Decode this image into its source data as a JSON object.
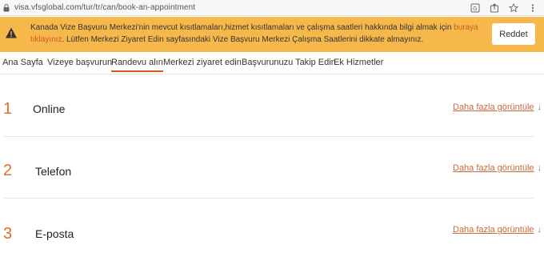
{
  "browser": {
    "url": "visa.vfsglobal.com/tur/tr/can/book-an-appointment"
  },
  "banner": {
    "text_before": "Kanada Vize Başvuru Merkezi'nin mevcut kısıtlamaları,hizmet kısıtlamaları ve çalışma saatleri hakkında bilgi almak için ",
    "link_text": "buraya tıklayınız",
    "text_after": ". Lütfen Merkezi Ziyaret Edin sayfasındaki Vize Başvuru Merkezi Çalışma Saatlerini dikkate almayınız.",
    "dismiss_label": "Reddet",
    "background_color": "#f7b84b",
    "link_color": "#d25a1f"
  },
  "nav": {
    "items": [
      {
        "label": "Ana Sayfa",
        "active": false
      },
      {
        "label": "Vizeye başvurun",
        "active": false
      },
      {
        "label": "Randevu alın",
        "active": true
      },
      {
        "label": "Merkezi ziyaret edin",
        "active": false
      },
      {
        "label": "Başvurunuzu Takip Edin",
        "active": false
      },
      {
        "label": "Ek Hizmetler",
        "active": false
      }
    ]
  },
  "appointments": [
    {
      "number": "1",
      "title": "Online",
      "more_label": "Daha fazla görüntüle"
    },
    {
      "number": "2",
      "title": "Telefon",
      "more_label": "Daha fazla görüntüle"
    },
    {
      "number": "3",
      "title": "E-posta",
      "more_label": "Daha fazla görüntüle"
    }
  ],
  "colors": {
    "accent": "#e06c2b",
    "link": "#c86a3a"
  }
}
